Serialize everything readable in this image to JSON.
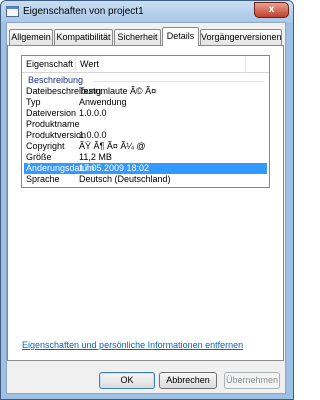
{
  "window": {
    "title": "Eigenschaften von project1",
    "close_label": "x"
  },
  "tabs": [
    {
      "label": "Allgemein"
    },
    {
      "label": "Kompatibilität"
    },
    {
      "label": "Sicherheit"
    },
    {
      "label": "Details",
      "active": true
    },
    {
      "label": "Vorgängerversionen"
    }
  ],
  "list": {
    "headers": {
      "property": "Eigenschaft",
      "value": "Wert"
    },
    "group_label": "Beschreibung",
    "rows": [
      {
        "name": "Dateibeschreibung",
        "value": "Testumlaute Ã© Ã¤"
      },
      {
        "name": "Typ",
        "value": "Anwendung"
      },
      {
        "name": "Dateiversion",
        "value": "1.0.0.0"
      },
      {
        "name": "Produktname",
        "value": ""
      },
      {
        "name": "Produktversion",
        "value": "1.0.0.0"
      },
      {
        "name": "Copyright",
        "value": "ÃŸ Ã¶ Ã¤ Ã¼ @"
      },
      {
        "name": "Größe",
        "value": "11,2 MB"
      },
      {
        "name": "Änderungsdatum",
        "value": "17.05.2009 18:02",
        "selected": true
      },
      {
        "name": "Sprache",
        "value": "Deutsch (Deutschland)"
      }
    ]
  },
  "link": "Eigenschaften und persönliche Informationen entfernen",
  "buttons": {
    "ok": "OK",
    "cancel": "Abbrechen",
    "apply": "Übernehmen"
  },
  "colors": {
    "selection": "#3399ff",
    "link": "#0066cc",
    "group_label": "#1e3287"
  }
}
